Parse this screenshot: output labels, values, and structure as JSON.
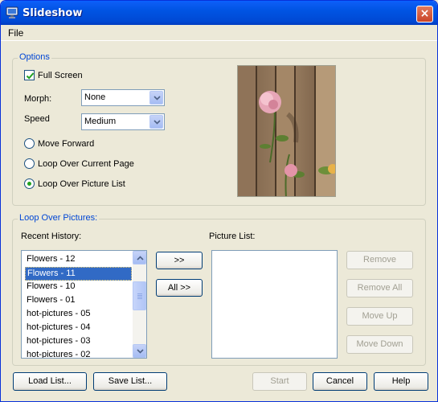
{
  "window": {
    "title": "Slideshow",
    "close_glyph": "×"
  },
  "menu": {
    "file": "File"
  },
  "options": {
    "legend": "Options",
    "full_screen": {
      "label": "Full Screen",
      "checked": true
    },
    "morph": {
      "label": "Morph:",
      "value": "None"
    },
    "speed": {
      "label": "Speed",
      "value": "Medium"
    },
    "radios": [
      {
        "label": "Move Forward",
        "selected": false
      },
      {
        "label": "Loop Over Current Page",
        "selected": false
      },
      {
        "label": "Loop Over Picture List",
        "selected": true
      }
    ]
  },
  "loop": {
    "legend": "Loop Over Pictures:",
    "recent_history_label": "Recent History:",
    "picture_list_label": "Picture List:",
    "recent_history": [
      "Flowers - 12",
      "Flowers - 11",
      "Flowers - 10",
      "Flowers - 01",
      "hot-pictures - 05",
      "hot-pictures - 04",
      "hot-pictures - 03",
      "hot-pictures - 02"
    ],
    "selected_index": 1,
    "add_button": ">>",
    "add_all_button": "All >>",
    "remove_button": "Remove",
    "remove_all_button": "Remove All",
    "move_up_button": "Move Up",
    "move_down_button": "Move Down"
  },
  "footer": {
    "load_list": "Load List...",
    "save_list": "Save List...",
    "start": "Start",
    "cancel": "Cancel",
    "help": "Help"
  },
  "icons": {
    "title_icon": "monitor-icon",
    "preview": "rose-photo"
  },
  "colors": {
    "titlebar": "#0054e3",
    "legend_text": "#0046d5",
    "selection": "#316ac5",
    "checkmark": "#21a121"
  }
}
